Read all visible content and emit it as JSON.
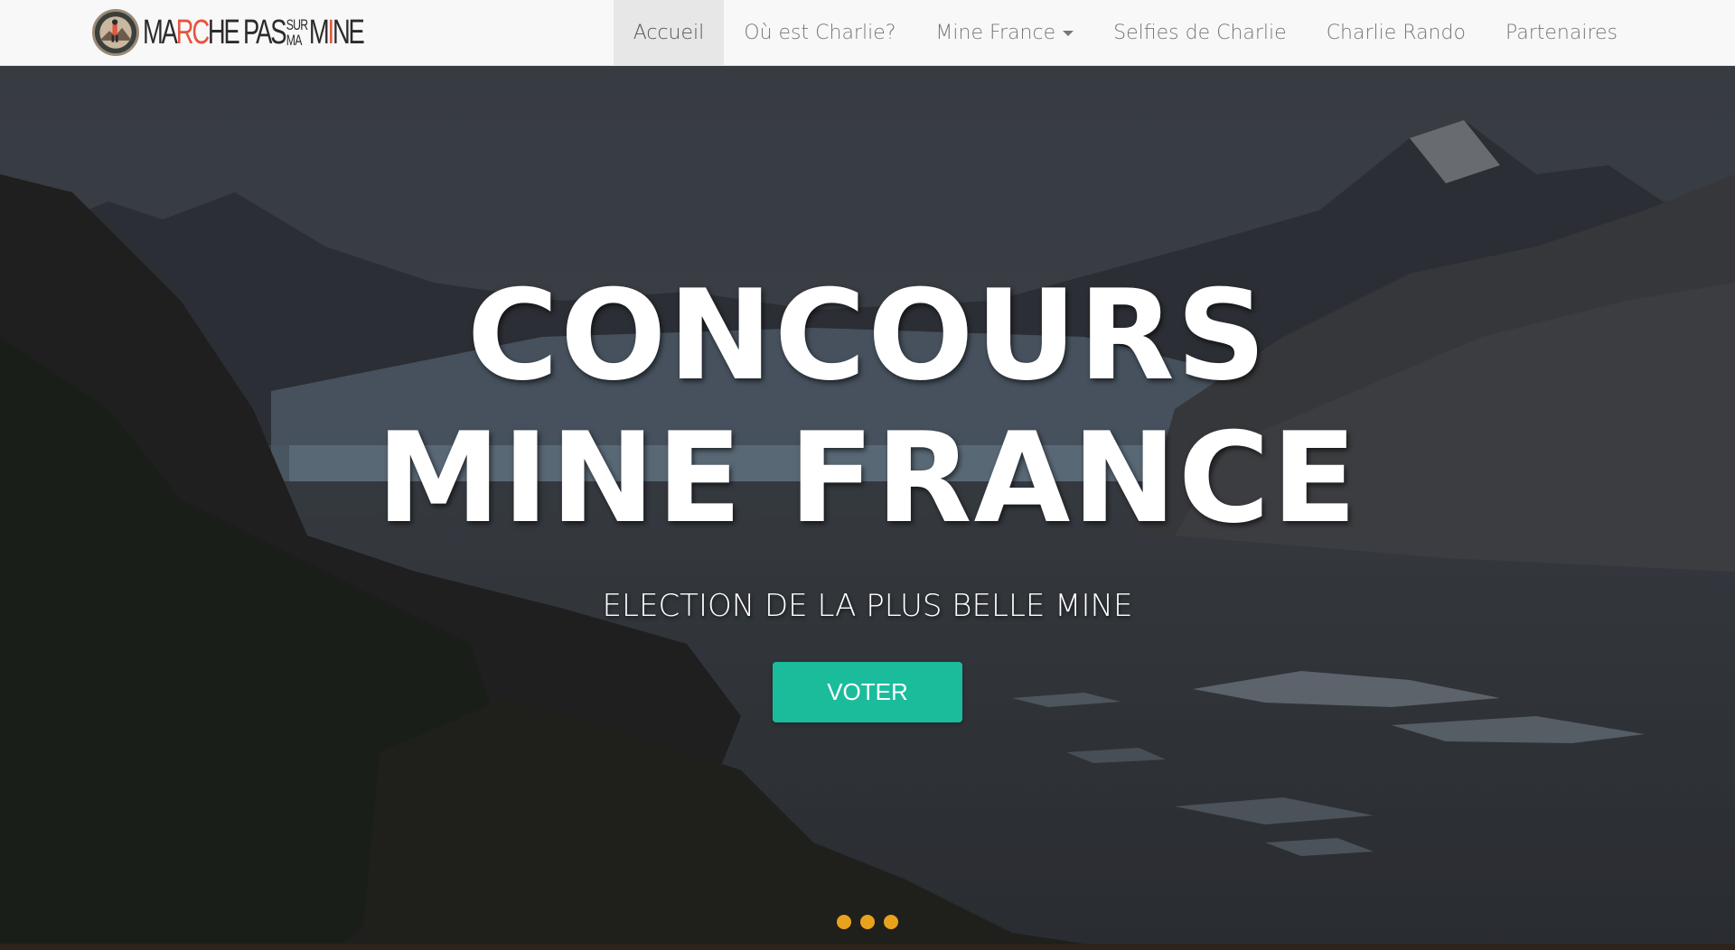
{
  "brand": {
    "logo_parts": [
      "MA",
      "R",
      "C",
      "HE PAS",
      "SUR",
      "MA",
      "M",
      "I",
      "NE"
    ],
    "logo_alt": "MARCHE PAS SUR MA MINE"
  },
  "nav": {
    "items": [
      {
        "label": "Accueil",
        "active": true
      },
      {
        "label": "Où est Charlie?"
      },
      {
        "label": "Mine France",
        "dropdown": true
      },
      {
        "label": "Selfies de Charlie"
      },
      {
        "label": "Charlie Rando"
      },
      {
        "label": "Partenaires"
      }
    ]
  },
  "hero": {
    "title": "CONCOURS MINE FRANCE",
    "subtitle": "ELECTION DE LA PLUS BELLE MINE",
    "button_label": "VOTER"
  },
  "carousel": {
    "slide_count": 3
  },
  "colors": {
    "accent": "#1abc9c",
    "carousel_dot": "#e8a21c",
    "navbar_bg": "#f8f8f8",
    "nav_active_bg": "#e7e7e7",
    "nav_text": "#777777",
    "logo_blue": "#2d4f8a",
    "logo_red": "#e4553f"
  },
  "icons": {
    "logo_badge": "hiker-badge-icon",
    "dropdown": "caret-down-icon"
  }
}
